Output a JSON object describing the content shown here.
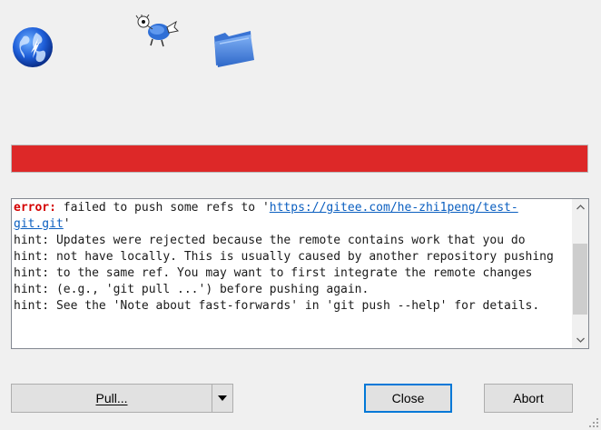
{
  "window": {
    "icons": [
      "globe-icon",
      "mascot-icon",
      "folder-icon"
    ]
  },
  "progress": {
    "fraction": 1.0,
    "color": "#dd2828"
  },
  "log": {
    "error_label": "error:",
    "line1_text": " failed to push some refs to '",
    "line1_link": "https://gitee.com/he-zhi1peng/test-",
    "line2_link": "git.git",
    "line2_end": "'",
    "hints": [
      "hint: Updates were rejected because the remote contains work that you do",
      "hint: not have locally. This is usually caused by another repository pushing",
      "hint: to the same ref. You may want to first integrate the remote changes",
      "hint: (e.g., 'git pull ...') before pushing again.",
      "hint: See the 'Note about fast-forwards' in 'git push --help' for details."
    ],
    "colors": {
      "error": "#d40000",
      "link": "#0b5fc0"
    }
  },
  "buttons": {
    "pull_label": "Pull...",
    "close_label": "Close",
    "abort_label": "Abort"
  }
}
